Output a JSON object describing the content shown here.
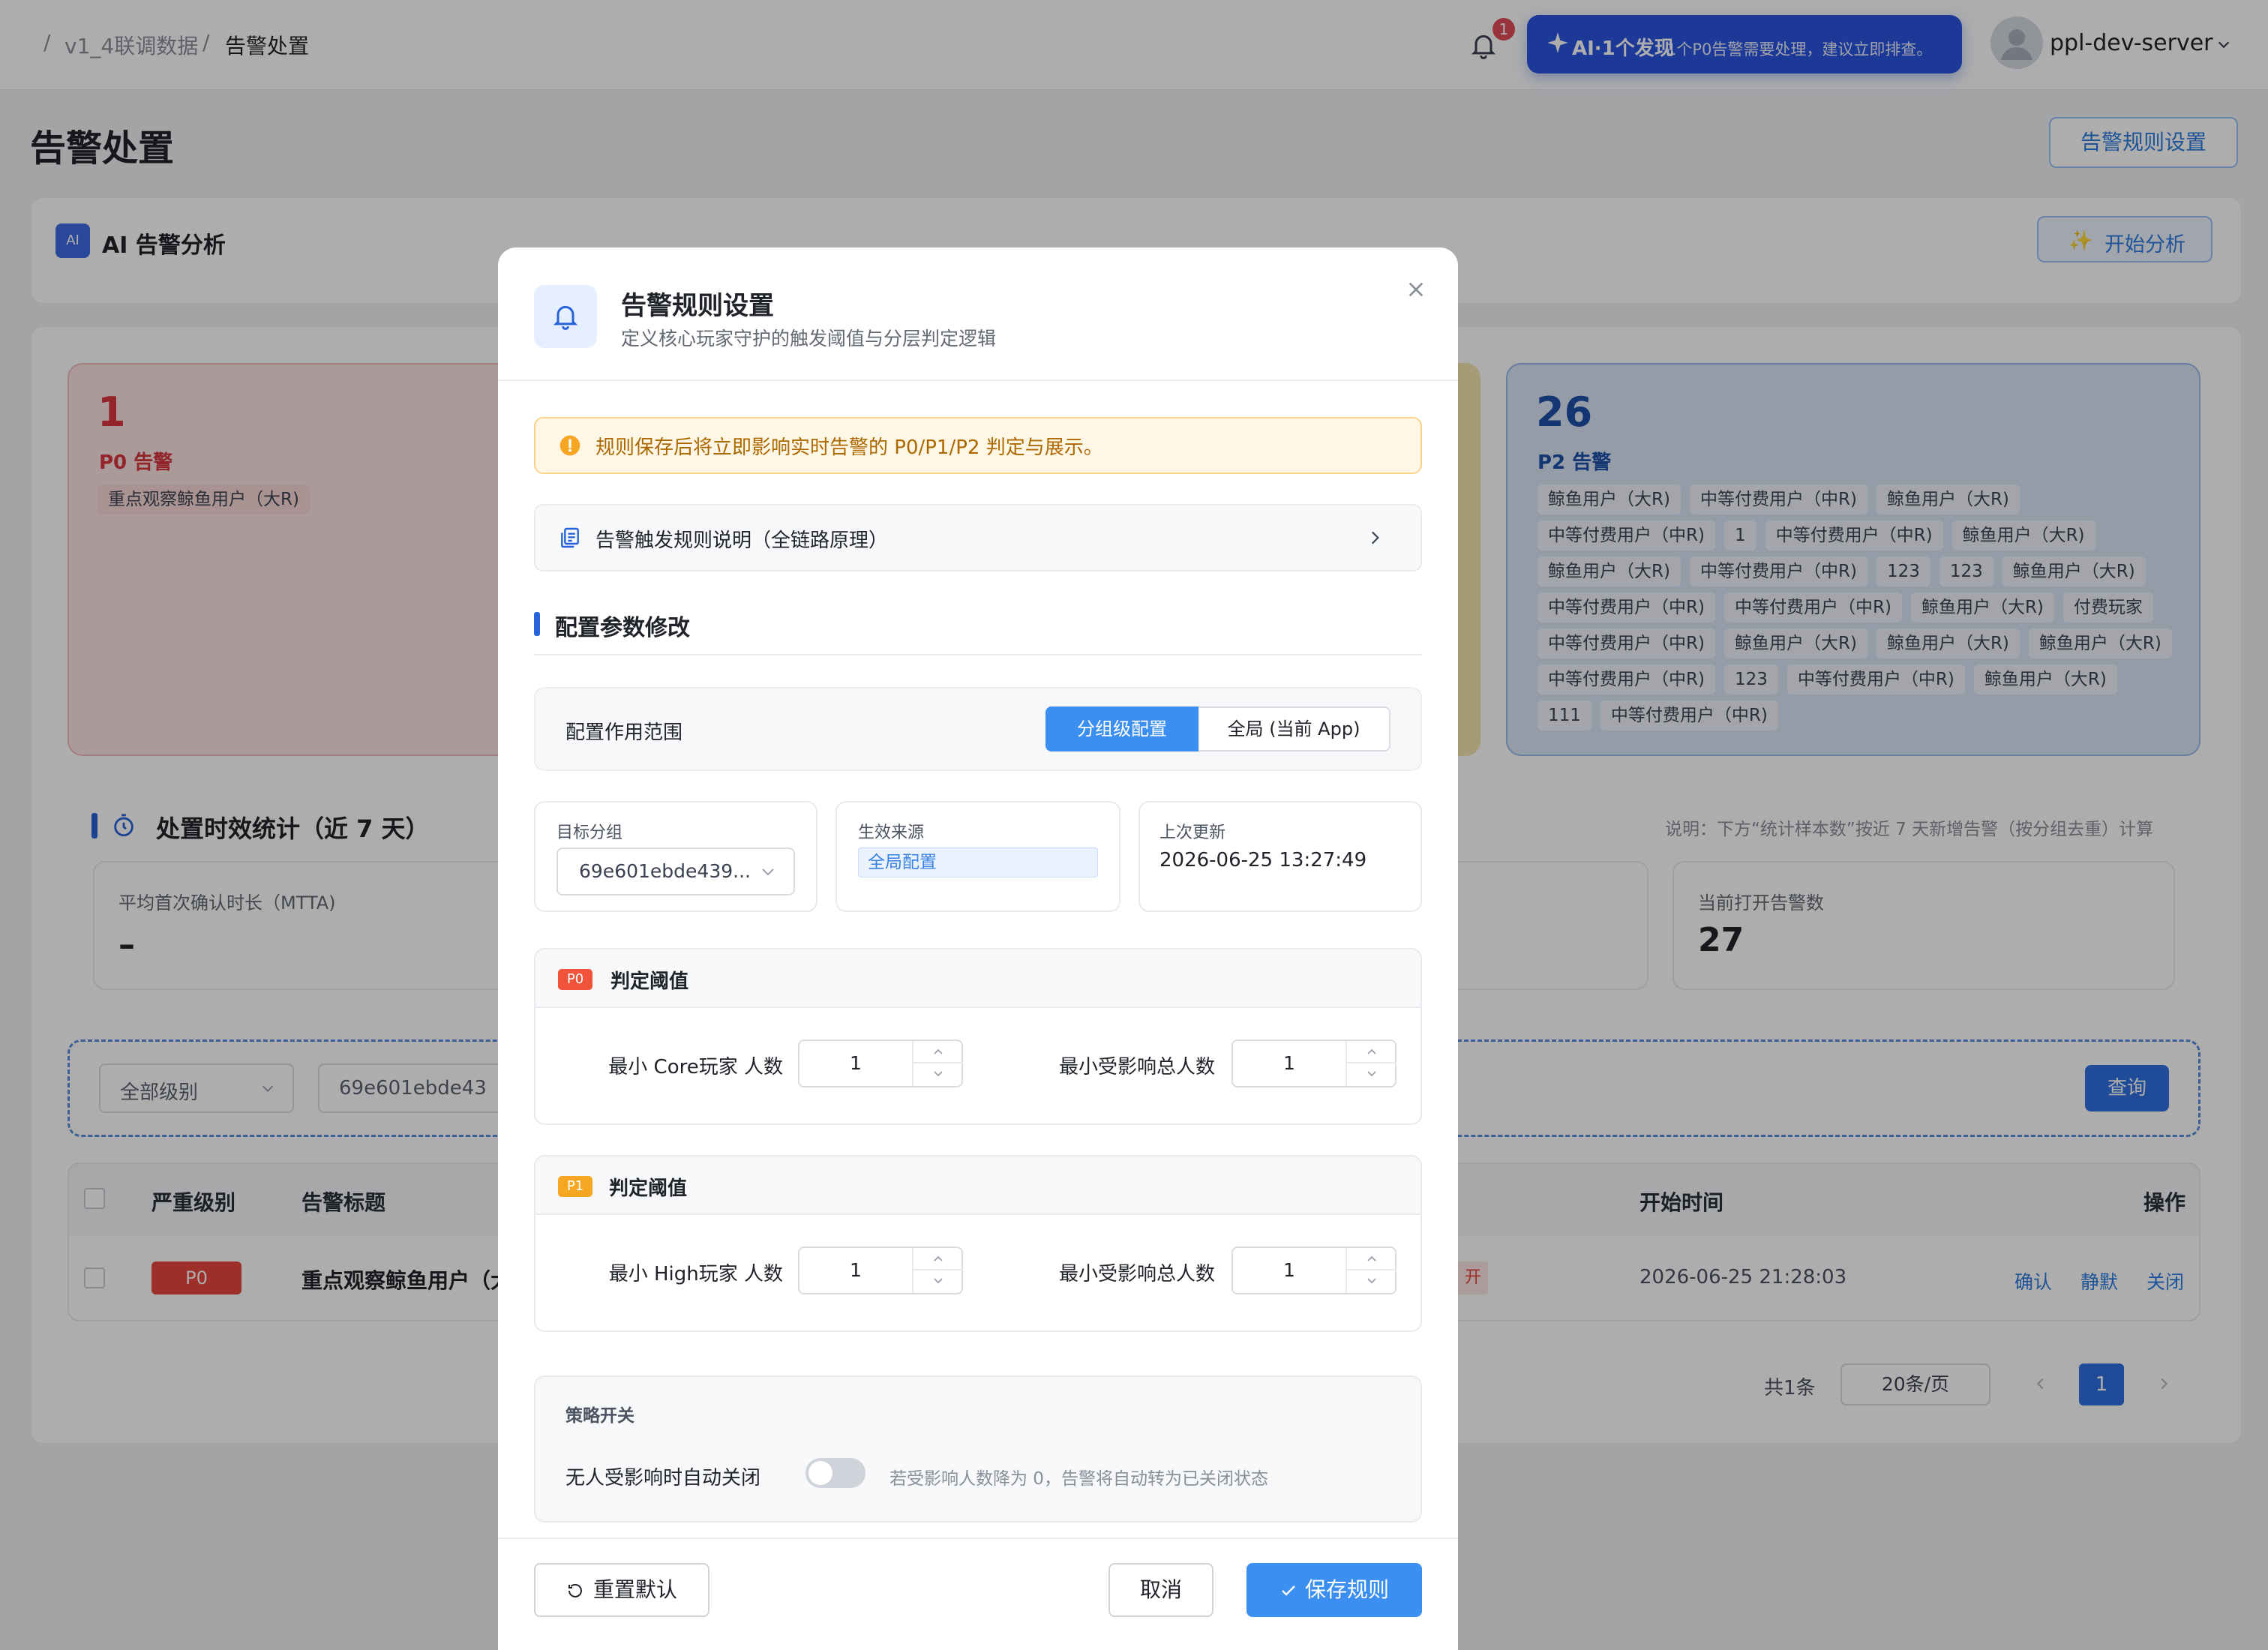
{
  "header": {
    "breadcrumbs": [
      "v1_4联调数据",
      "告警处置"
    ],
    "notification_count": "1",
    "ai_banner": {
      "prefix": "AI·1个发现",
      "text": "1个P0告警需要处理，建议立即排查。"
    },
    "user_name": "ppl-dev-server"
  },
  "page": {
    "title": "告警处置",
    "rule_settings_button": "告警规则设置",
    "ai_panel": {
      "badge": "AI",
      "title": "AI 告警分析",
      "start_button": "开始分析"
    },
    "cards": {
      "p0": {
        "count": "1",
        "label": "P0 告警",
        "tags": [
          "重点观察鲸鱼用户（大R)"
        ]
      },
      "p2": {
        "count": "26",
        "label": "P2 告警",
        "tags": [
          "鲸鱼用户（大R)",
          "中等付费用户（中R)",
          "鲸鱼用户（大R)",
          "中等付费用户（中R)",
          "1",
          "中等付费用户（中R)",
          "鲸鱼用户（大R)",
          "鲸鱼用户（大R)",
          "中等付费用户（中R)",
          "123",
          "123",
          "鲸鱼用户（大R)",
          "中等付费用户（中R)",
          "中等付费用户（中R)",
          "鲸鱼用户（大R)",
          "付费玩家",
          "中等付费用户（中R)",
          "鲸鱼用户（大R)",
          "鲸鱼用户（大R)",
          "鲸鱼用户（大R)",
          "中等付费用户（中R)",
          "123",
          "中等付费用户（中R)",
          "鲸鱼用户（大R)",
          "111",
          "中等付费用户（中R)"
        ]
      }
    },
    "stats": {
      "title": "处置时效统计（近 7 天）",
      "note": "说明：下方“统计样本数”按近 7 天新增告警（按分组去重）计算",
      "mtta_label": "平均首次确认时长（MTTA)",
      "mtta_value": "–",
      "open_label": "当前打开告警数",
      "open_value": "27"
    },
    "filters": {
      "level": "全部级别",
      "group": "69e601ebde43",
      "query_button": "查询"
    },
    "table": {
      "headers": {
        "level": "严重级别",
        "title": "告警标题",
        "start": "开始时间",
        "actions": "操作"
      },
      "rows": [
        {
          "level": "P0",
          "title": "重点观察鲸鱼用户（大R)",
          "status_fragment": "开",
          "start": "2026-06-25 21:28:03",
          "actions": [
            "确认",
            "静默",
            "关闭"
          ]
        }
      ]
    },
    "pagination": {
      "total": "共1条",
      "page_size": "20条/页",
      "current": "1"
    }
  },
  "modal": {
    "title": "告警规则设置",
    "subtitle": "定义核心玩家守护的触发阈值与分层判定逻辑",
    "warning": "规则保存后将立即影响实时告警的 P0/P1/P2 判定与展示。",
    "rule_doc": "告警触发规则说明（全链路原理）",
    "section_title": "配置参数修改",
    "scope": {
      "label": "配置作用范围",
      "options": [
        "分组级配置",
        "全局 (当前 App)"
      ],
      "selected": "分组级配置"
    },
    "target_group": {
      "label": "目标分组",
      "value": "69e601ebde439..."
    },
    "source": {
      "label": "生效来源",
      "value": "全局配置"
    },
    "updated": {
      "label": "上次更新",
      "value": "2026-06-25 13:27:49"
    },
    "p0": {
      "badge": "P0",
      "title": "判定阈值",
      "min_core_label": "最小 Core玩家 人数",
      "min_core_value": "1",
      "min_total_label": "最小受影响总人数",
      "min_total_value": "1"
    },
    "p1": {
      "badge": "P1",
      "title": "判定阈值",
      "min_high_label": "最小 High玩家 人数",
      "min_high_value": "1",
      "min_total_label": "最小受影响总人数",
      "min_total_value": "1"
    },
    "strategy": {
      "title": "策略开关",
      "toggle_label": "无人受影响时自动关闭",
      "toggle_on": false,
      "toggle_desc": "若受影响人数降为 0，告警将自动转为已关闭状态"
    },
    "footer": {
      "reset": "重置默认",
      "cancel": "取消",
      "save": "保存规则"
    }
  },
  "colors": {
    "primary": "#3b8ff0",
    "p0": "#e8453c",
    "p1": "#f5a623",
    "p2": "#2962d9",
    "warning_bg": "#fff7e6"
  }
}
